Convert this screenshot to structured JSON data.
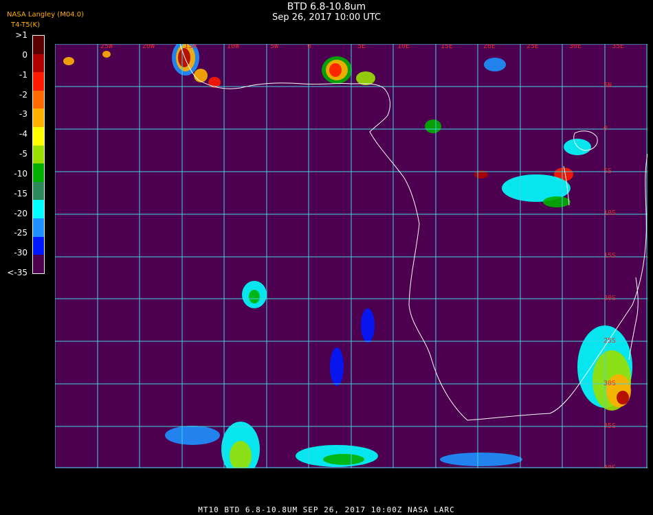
{
  "header": {
    "title": "BTD 6.8-10.8um",
    "subtitle": "Sep 26, 2017 10:00 UTC",
    "org_label": "NASA Langley (M04.0)",
    "units_label": "T4-T5(K)"
  },
  "colorbar": {
    "labels": [
      ">1",
      "0",
      "-1",
      "-2",
      "-3",
      "-4",
      "-5",
      "-10",
      "-15",
      "-20",
      "-25",
      "-30",
      "<-35"
    ],
    "colors": [
      "#5a0000",
      "#b00000",
      "#ff1a00",
      "#ff6a00",
      "#ffb000",
      "#ffff00",
      "#9adf00",
      "#00b000",
      "#2a8a5a",
      "#00ffff",
      "#1e90ff",
      "#0018ff",
      "#4d004f"
    ]
  },
  "map": {
    "background_color": "#4d004f",
    "grid_color": "#3fd4e6",
    "label_color": "#e0302a",
    "coast_color": "#ffffff",
    "lon_labels": [
      "25W",
      "20W",
      "15W",
      "10W",
      "5W",
      "0",
      "5E",
      "10E",
      "15E",
      "20E",
      "25E",
      "30E",
      "35E"
    ],
    "lat_labels": [
      "5N",
      "0",
      "5S",
      "10S",
      "15S",
      "20S",
      "25S",
      "30S",
      "35S",
      "40S"
    ]
  },
  "footer": {
    "text": "MT10  BTD 6.8-10.8UM    SEP 26, 2017 10:00Z    NASA LARC"
  }
}
